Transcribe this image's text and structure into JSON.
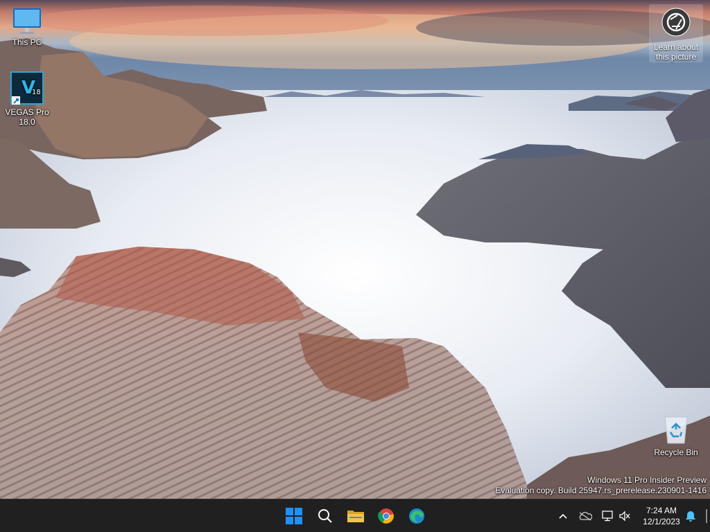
{
  "desktop": {
    "icons": [
      {
        "name": "this-pc",
        "label": "This PC"
      },
      {
        "name": "vegas-pro",
        "label": "VEGAS Pro\n18.0",
        "badge": "18",
        "letter": "V"
      },
      {
        "name": "recycle-bin",
        "label": "Recycle Bin"
      }
    ],
    "spotlight": {
      "label": "Learn about\nthis picture",
      "icon": "camera-aperture-icon"
    },
    "watermark": {
      "line1": "Windows 11 Pro Insider Preview",
      "line2": "Evaluation copy. Build 25947.rs_prerelease.230901-1416"
    }
  },
  "taskbar": {
    "pinned": [
      {
        "name": "start",
        "icon": "windows-logo-icon"
      },
      {
        "name": "search",
        "icon": "search-icon"
      },
      {
        "name": "file-explorer",
        "icon": "folder-icon"
      },
      {
        "name": "chrome",
        "icon": "chrome-icon"
      },
      {
        "name": "edge",
        "icon": "edge-icon"
      }
    ],
    "tray": {
      "icons": [
        "chevron-up-icon",
        "onedrive-cloud-icon",
        "network-icon",
        "volume-muted-icon"
      ],
      "time": "7:24 AM",
      "date": "12/1/2023",
      "notification_icon": "bell-icon"
    }
  },
  "colors": {
    "taskbar_bg": "#202020",
    "windows_blue": "#0078D4",
    "folder_yellow": "#F4C542",
    "bell_blue": "#4CC2FF"
  }
}
